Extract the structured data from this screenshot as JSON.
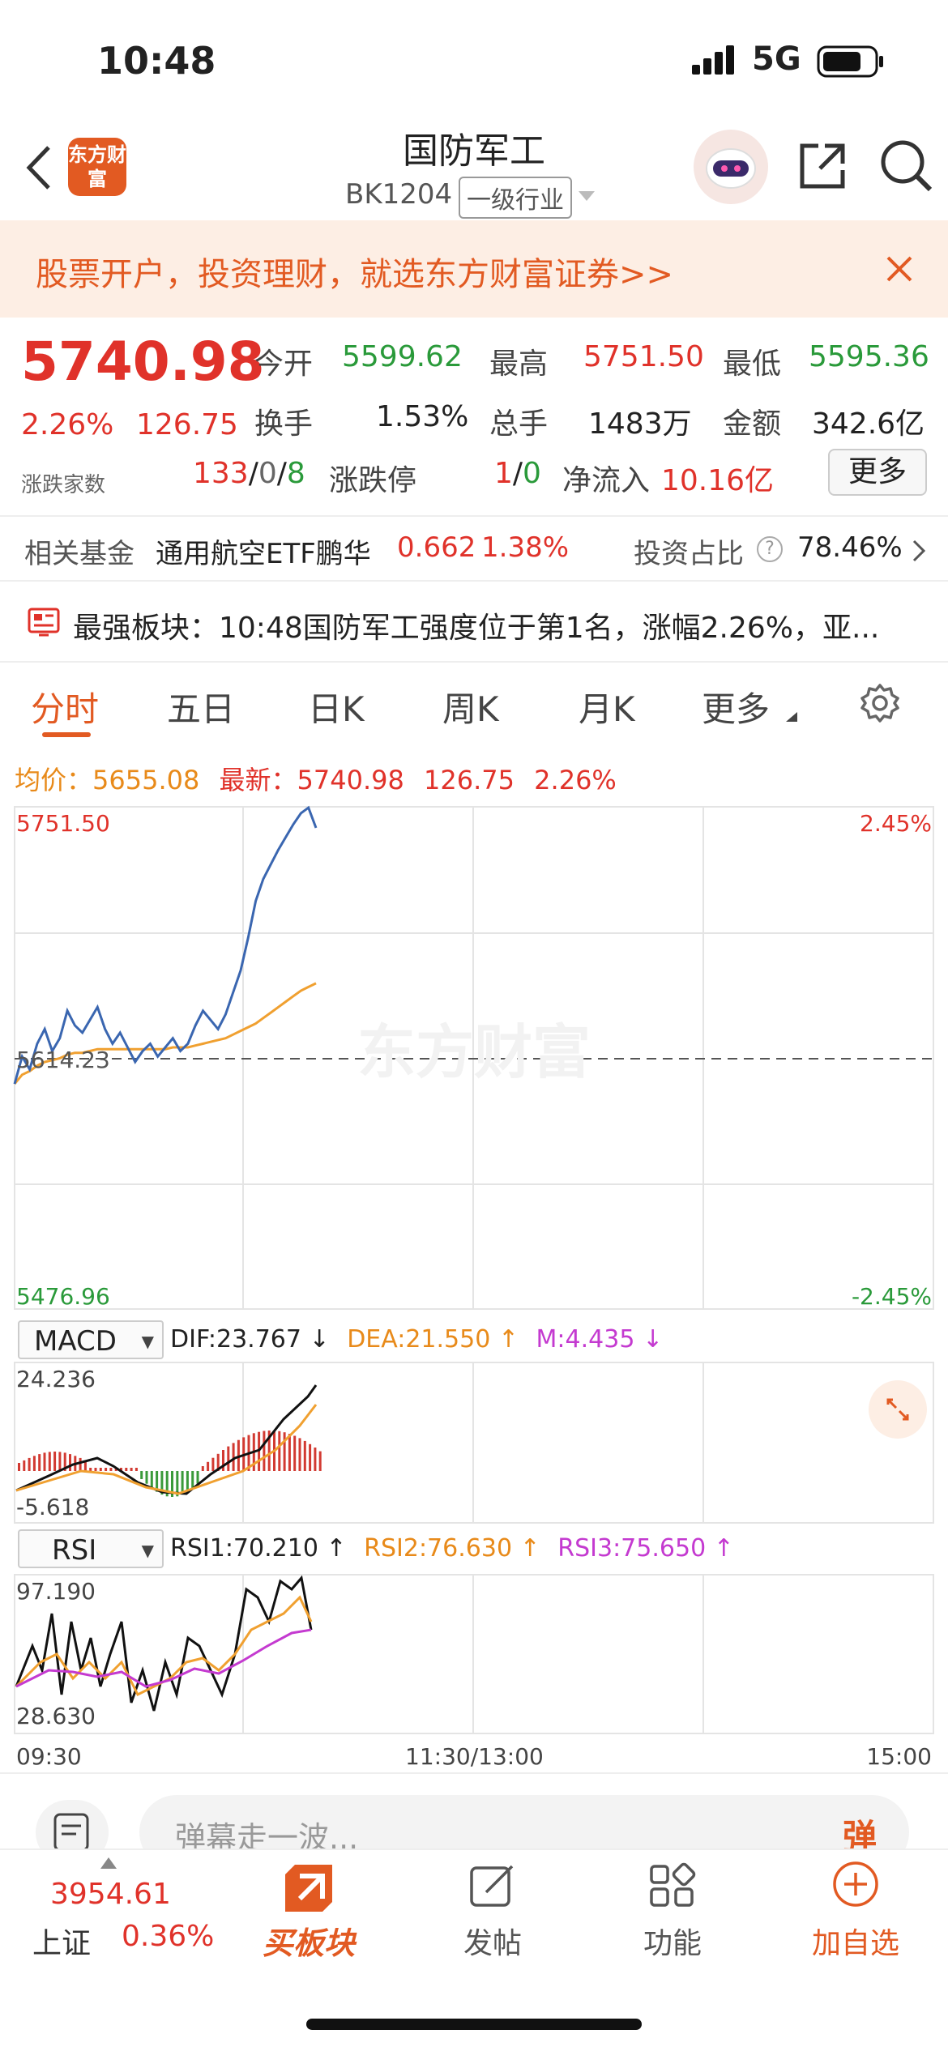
{
  "status_bar": {
    "time": "10:48",
    "network": "5G"
  },
  "nav": {
    "title": "国防军工",
    "code": "BK1204",
    "tag": "一级行业",
    "logo_text": "东方财富"
  },
  "banner": {
    "text": "股票开户，投资理财，就选东方财富证券>>"
  },
  "quote": {
    "price": "5740.98",
    "change_pct": "2.26%",
    "change_abs": "126.75",
    "open_label": "今开",
    "open": "5599.62",
    "high_label": "最高",
    "high": "5751.50",
    "low_label": "最低",
    "low": "5595.36",
    "turnover_label": "换手",
    "turnover": "1.53%",
    "volume_label": "总手",
    "volume": "1483万",
    "amount_label": "金额",
    "amount": "342.6亿",
    "breadth_label": "涨跌家数",
    "breadth_up": "133",
    "breadth_flat": "0",
    "breadth_down": "8",
    "limit_label": "涨跌停",
    "limit_up": "1",
    "limit_down": "0",
    "net_inflow_label": "净流入",
    "net_inflow": "10.16亿",
    "more_button": "更多"
  },
  "fund": {
    "label": "相关基金",
    "name": "通用航空ETF鹏华",
    "price": "0.662",
    "pct": "1.38%",
    "ratio_label": "投资占比",
    "ratio": "78.46%"
  },
  "news": {
    "text": "最强板块：10:48国防军工强度位于第1名，涨幅2.26%，亚..."
  },
  "tabs": [
    "分时",
    "五日",
    "日K",
    "周K",
    "月K",
    "更多"
  ],
  "chart_info": {
    "avg_label": "均价：",
    "avg": "5655.08",
    "latest_label": "最新：",
    "latest": "5740.98",
    "latest_change": "126.75",
    "latest_pct": "2.26%"
  },
  "chart_axis": {
    "y_top": "5751.50",
    "y_mid": "5614.23",
    "y_bottom": "5476.96",
    "pct_top": "2.45%",
    "pct_bottom": "-2.45%",
    "watermark": "东方财富"
  },
  "macd": {
    "selector": "MACD",
    "dif": "DIF:23.767 ↓",
    "dea": "DEA:21.550 ↑",
    "m": "M:4.435 ↓",
    "y_top": "24.236",
    "y_bottom": "-5.618"
  },
  "rsi": {
    "selector": "RSI",
    "rsi1": "RSI1:70.210 ↑",
    "rsi2": "RSI2:76.630 ↑",
    "rsi3": "RSI3:75.650 ↑",
    "y_top": "97.190",
    "y_bottom": "28.630"
  },
  "x_axis": {
    "start": "09:30",
    "mid": "11:30/13:00",
    "end": "15:00"
  },
  "comment": {
    "placeholder": "弹幕走一波...",
    "danmu_button": "弹"
  },
  "bottom_bar": {
    "index_value": "3954.61",
    "index_name": "上证",
    "index_pct": "0.36%",
    "buy_label": "买板块",
    "post_label": "发帖",
    "func_label": "功能",
    "add_label": "加自选"
  },
  "colors": {
    "up": "#e0322a",
    "down": "#2a9a3a",
    "accent": "#e25a22",
    "price_line": "#3a66b0",
    "avg_line": "#f0a030"
  },
  "chart_data": {
    "type": "line",
    "title": "",
    "xlabel": "",
    "ylabel": "",
    "x_range": [
      "09:30",
      "15:00"
    ],
    "ylim": [
      5476.96,
      5751.5
    ],
    "series": [
      {
        "values": [
          5600,
          5615,
          5608,
          5622,
          5630,
          5618,
          5625,
          5640,
          5632,
          5628,
          5635,
          5642,
          5630,
          5622,
          5628,
          5620,
          5612,
          5618,
          5622,
          5615,
          5620,
          5625,
          5618,
          5622,
          5632,
          5640,
          5635,
          5630,
          5638,
          5650,
          5662,
          5680,
          5700,
          5712,
          5720,
          5728,
          5735,
          5742,
          5748,
          5751,
          5740
        ]
      },
      {
        "values": [
          5600,
          5605,
          5607,
          5610,
          5612,
          5613,
          5614,
          5616,
          5617,
          5617,
          5618,
          5619,
          5619,
          5619,
          5619,
          5619,
          5619,
          5619,
          5619,
          5619,
          5619,
          5620,
          5620,
          5620,
          5621,
          5622,
          5623,
          5624,
          5625,
          5627,
          5629,
          5631,
          5633,
          5636,
          5639,
          5642,
          5645,
          5648,
          5651,
          5653,
          5655
        ]
      }
    ]
  }
}
